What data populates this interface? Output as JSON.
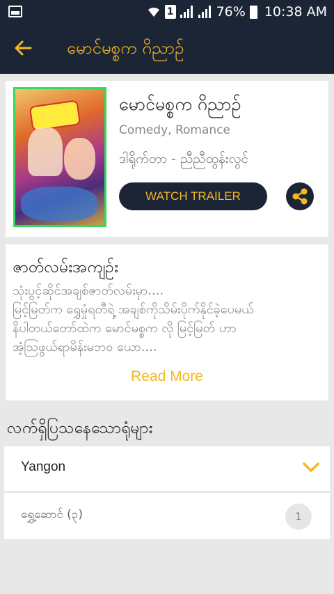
{
  "status_bar": {
    "battery": "76%",
    "time": "10:38 AM",
    "sim_label": "1"
  },
  "app_bar": {
    "title": "မောင်မစ္စက ဂိညာဉ်",
    "back_icon": "back-arrow-icon"
  },
  "movie": {
    "title": "မောင်မစ္စက ဂိညာဉ်",
    "genres": "Comedy, Romance",
    "director": "ဒါရိုက်တာ - ညီညီထွန်းလွင်",
    "trailer_label": "WATCH TRAILER",
    "share_icon": "share-icon"
  },
  "synopsis": {
    "heading": "ဇာတ်လမ်းအကျဉ်း",
    "lines": [
      "သုံးပွင့်ဆိုင်အချစ်ဇာတ်လမ်းမှာ....",
      "မြင့်မြတ်က ရွှေမှုံရတီရဲ့ အချစ်ကိုသိမ်းပိုက်နိုင်ခဲ့ပေမယ်",
      "နိပါတယ်တော်ထဲက မောင်မစ္စက လို မြင့်မြတ် ဟာ",
      "အံ့သြဖွယ်ရာမိန်းမဘဝ ယော...."
    ],
    "read_more": "Read More"
  },
  "showing": {
    "heading": "လက်ရှိပြသနေသောရုံများ",
    "city": "Yangon",
    "cinemas": [
      {
        "name": "ရွှေ့ဆောင် (၃)",
        "count": "1"
      }
    ]
  },
  "colors": {
    "primary_dark": "#1c2536",
    "accent": "#f5b820",
    "poster_border": "#2fdc5c"
  }
}
